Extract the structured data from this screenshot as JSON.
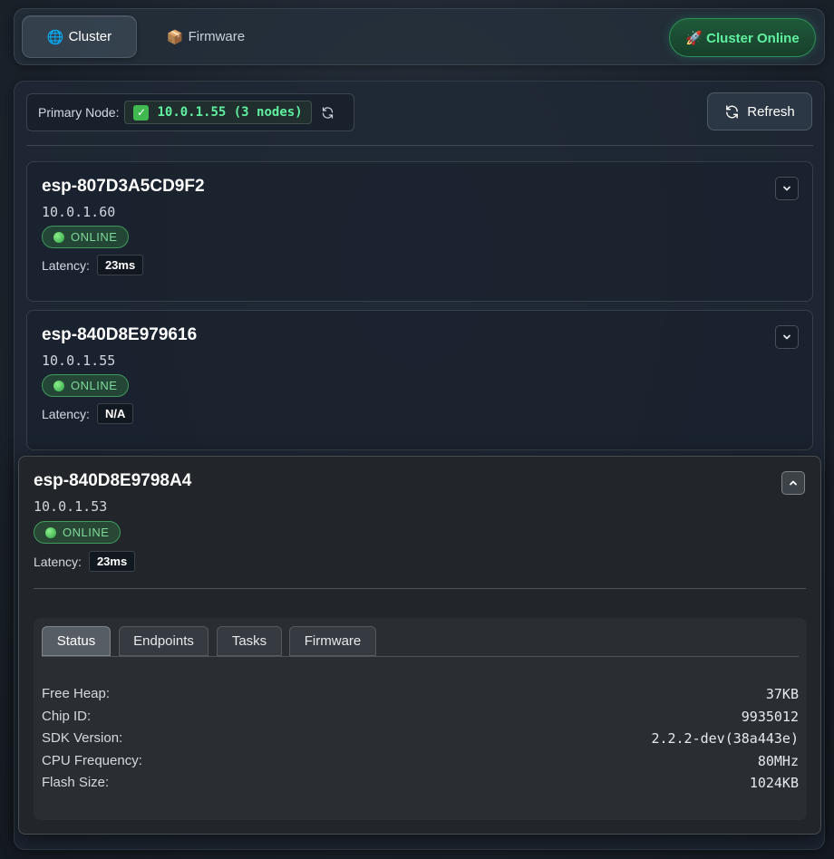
{
  "nav": {
    "tabs": [
      {
        "emoji": "🌐",
        "label": "Cluster",
        "active": true
      },
      {
        "emoji": "📦",
        "label": "Firmware",
        "active": false
      }
    ],
    "cluster_status": "🚀 Cluster Online"
  },
  "primary": {
    "label": "Primary Node:",
    "value": "10.0.1.55 (3 nodes)",
    "check": "✓"
  },
  "toolbar": {
    "refresh_label": "Refresh"
  },
  "nodes": [
    {
      "name": "esp-807D3A5CD9F2",
      "ip": "10.0.1.60",
      "status": "ONLINE",
      "latency_label": "Latency:",
      "latency": "23ms",
      "expanded": false
    },
    {
      "name": "esp-840D8E979616",
      "ip": "10.0.1.55",
      "status": "ONLINE",
      "latency_label": "Latency:",
      "latency": "N/A",
      "expanded": false
    },
    {
      "name": "esp-840D8E9798A4",
      "ip": "10.0.1.53",
      "status": "ONLINE",
      "latency_label": "Latency:",
      "latency": "23ms",
      "expanded": true
    }
  ],
  "details": {
    "tabs": [
      "Status",
      "Endpoints",
      "Tasks",
      "Firmware"
    ],
    "active_tab": "Status",
    "rows": [
      {
        "key": "Free Heap:",
        "value": "37KB"
      },
      {
        "key": "Chip ID:",
        "value": "9935012"
      },
      {
        "key": "SDK Version:",
        "value": "2.2.2-dev(38a443e)"
      },
      {
        "key": "CPU Frequency:",
        "value": "80MHz"
      },
      {
        "key": "Flash Size:",
        "value": "1024KB"
      }
    ]
  },
  "colors": {
    "accent_green": "#5ff0a0",
    "online_green": "#3f9a5b",
    "background": "#1c242d"
  }
}
